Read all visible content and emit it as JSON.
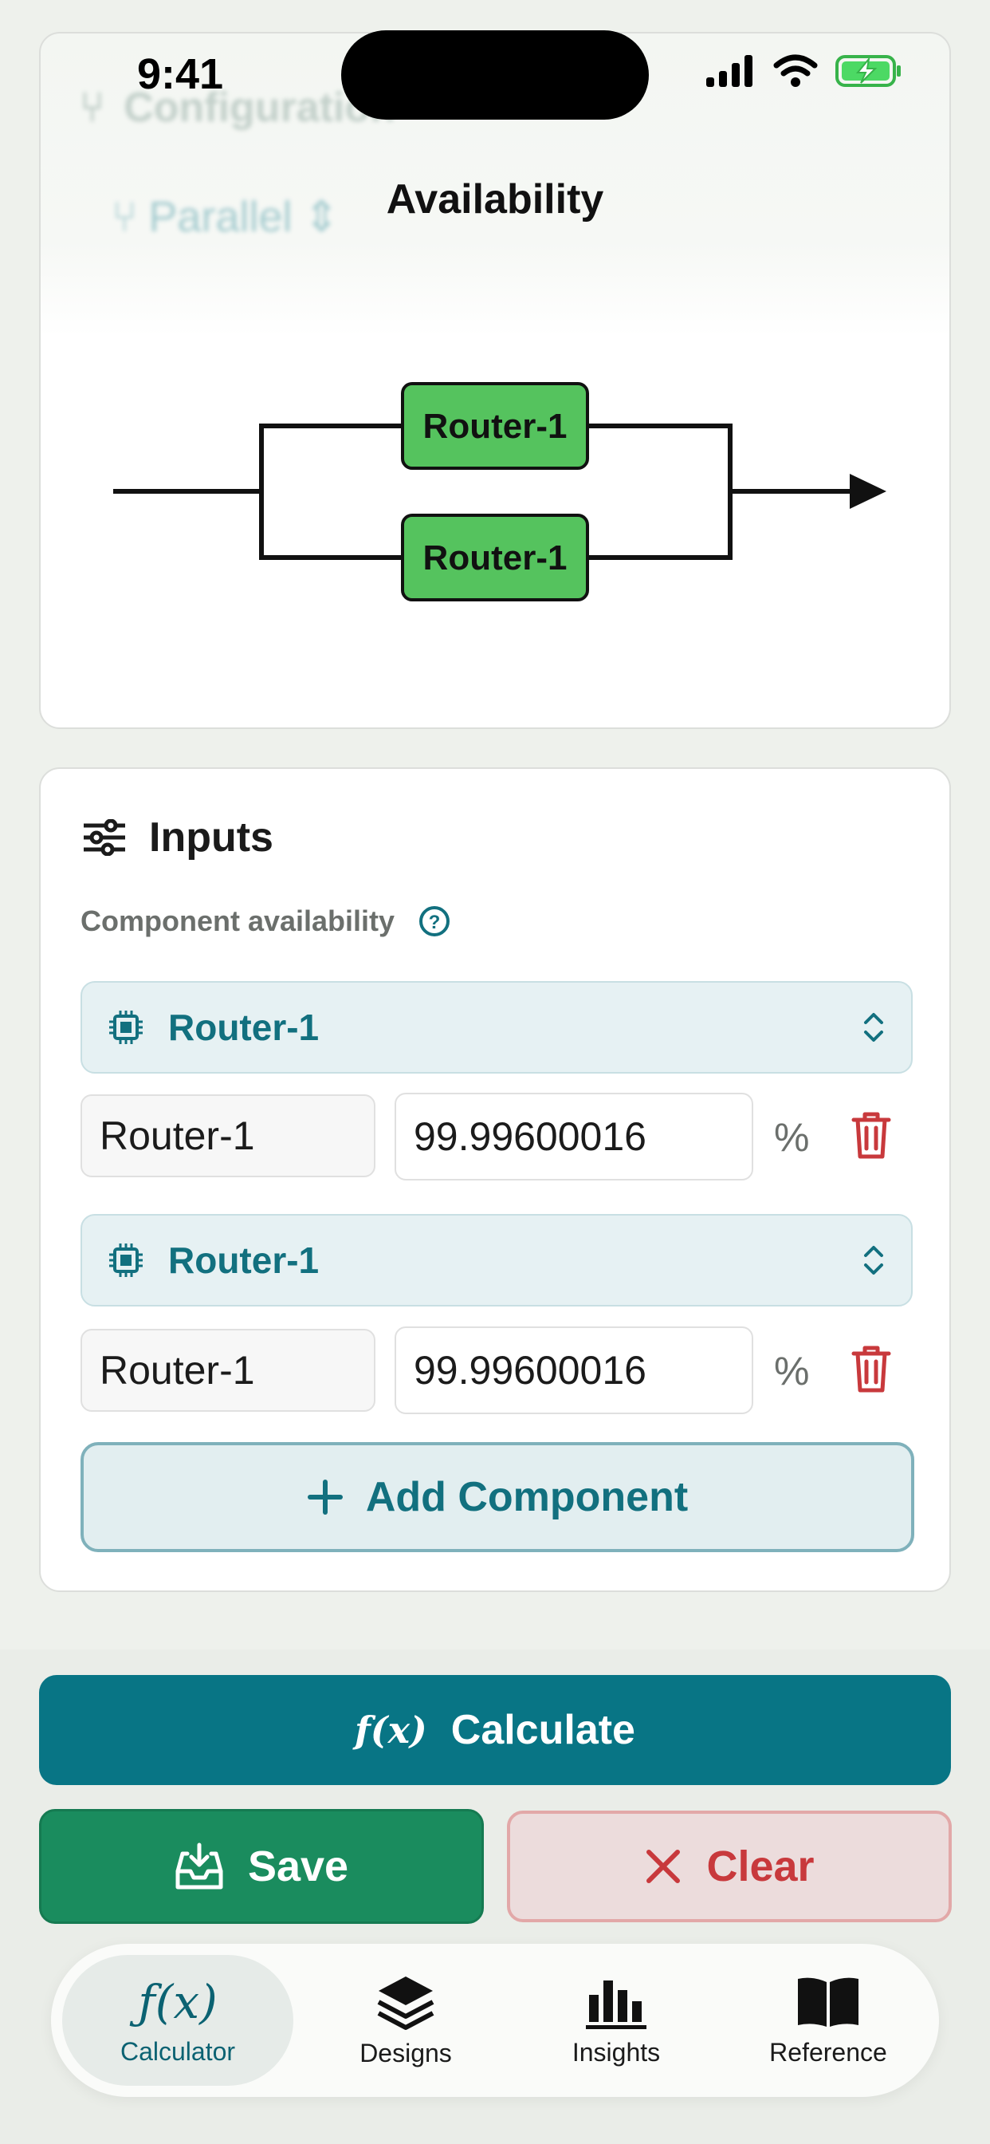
{
  "status_bar": {
    "time": "9:41"
  },
  "background_peek": {
    "section": "Configuration",
    "mode": "Parallel"
  },
  "diagram": {
    "title": "Availability",
    "blocks": [
      "Router-1",
      "Router-1"
    ],
    "block_color": "#55c35e"
  },
  "inputs": {
    "title": "Inputs",
    "sublabel": "Component availability",
    "components": [
      {
        "picker_label": "Router-1",
        "name": "Router-1",
        "value": "99.99600016",
        "unit": "%"
      },
      {
        "picker_label": "Router-1",
        "name": "Router-1",
        "value": "99.99600016",
        "unit": "%"
      }
    ],
    "add_label": "Add Component"
  },
  "actions": {
    "calculate_icon": "f(x)",
    "calculate_label": "Calculate",
    "save_label": "Save",
    "clear_label": "Clear"
  },
  "tabs": [
    {
      "label": "Calculator",
      "icon": "function-icon",
      "active": true
    },
    {
      "label": "Designs",
      "icon": "layers-icon",
      "active": false
    },
    {
      "label": "Insights",
      "icon": "bar-chart-icon",
      "active": false
    },
    {
      "label": "Reference",
      "icon": "book-icon",
      "active": false
    }
  ],
  "colors": {
    "accent": "#087585",
    "save": "#1a8c5e",
    "clear_text": "#c8393c",
    "picker_text": "#12707f"
  }
}
